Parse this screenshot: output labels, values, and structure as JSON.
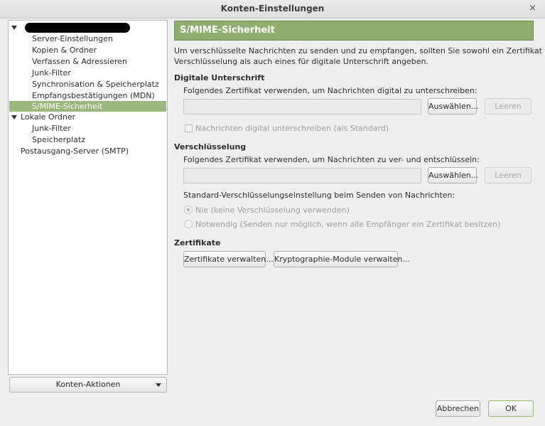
{
  "window": {
    "title": "Konten-Einstellungen",
    "close_glyph": "×"
  },
  "tree": {
    "items": [
      {
        "label": "",
        "redacted": true
      },
      {
        "label": "Server-Einstellungen"
      },
      {
        "label": "Kopien & Ordner"
      },
      {
        "label": "Verfassen & Adressieren"
      },
      {
        "label": "Junk-Filter"
      },
      {
        "label": "Synchronisation & Speicherplatz"
      },
      {
        "label": "Empfangsbestätigungen (MDN)"
      },
      {
        "label": "S/MIME-Sicherheit",
        "selected": true
      },
      {
        "label": "Lokale Ordner"
      },
      {
        "label": "Junk-Filter"
      },
      {
        "label": "Speicherplatz"
      },
      {
        "label": "Postausgang-Server (SMTP)"
      }
    ]
  },
  "account_actions_label": "Konten-Aktionen",
  "panel": {
    "title": "S/MIME-Sicherheit",
    "intro_line1": "Um verschlüsselte Nachrichten zu senden und zu empfangen, sollten Sie sowohl ein Zertifikat für",
    "intro_line2": "Verschlüsselung als auch eines für digitale Unterschrift angeben.",
    "signing": {
      "heading": "Digitale Unterschrift",
      "description": "Folgendes Zertifikat verwenden, um Nachrichten digital zu unterschreiben:",
      "value": "",
      "choose_label": "Auswählen...",
      "clear_label": "Leeren",
      "checkbox_label": "Nachrichten digital unterschreiben (als Standard)"
    },
    "encryption": {
      "heading": "Verschlüsselung",
      "description": "Folgendes Zertifikat verwenden, um Nachrichten zu ver- und entschlüsseln:",
      "value": "",
      "choose_label": "Auswählen...",
      "clear_label": "Leeren",
      "default_label": "Standard-Verschlüsselungseinstellung beim Senden von Nachrichten:",
      "option_never": "Nie (keine Verschlüsselung verwenden)",
      "option_required": "Notwendig (Senden nur möglich, wenn alle Empfänger ein Zertifikat besitzen)"
    },
    "certificates": {
      "heading": "Zertifikate",
      "manage_certs_label": "Zertifikate verwalten...",
      "manage_modules_label": "Kryptographie-Module verwalten..."
    }
  },
  "footer": {
    "cancel_label": "Abbrechen",
    "ok_label": "OK"
  }
}
